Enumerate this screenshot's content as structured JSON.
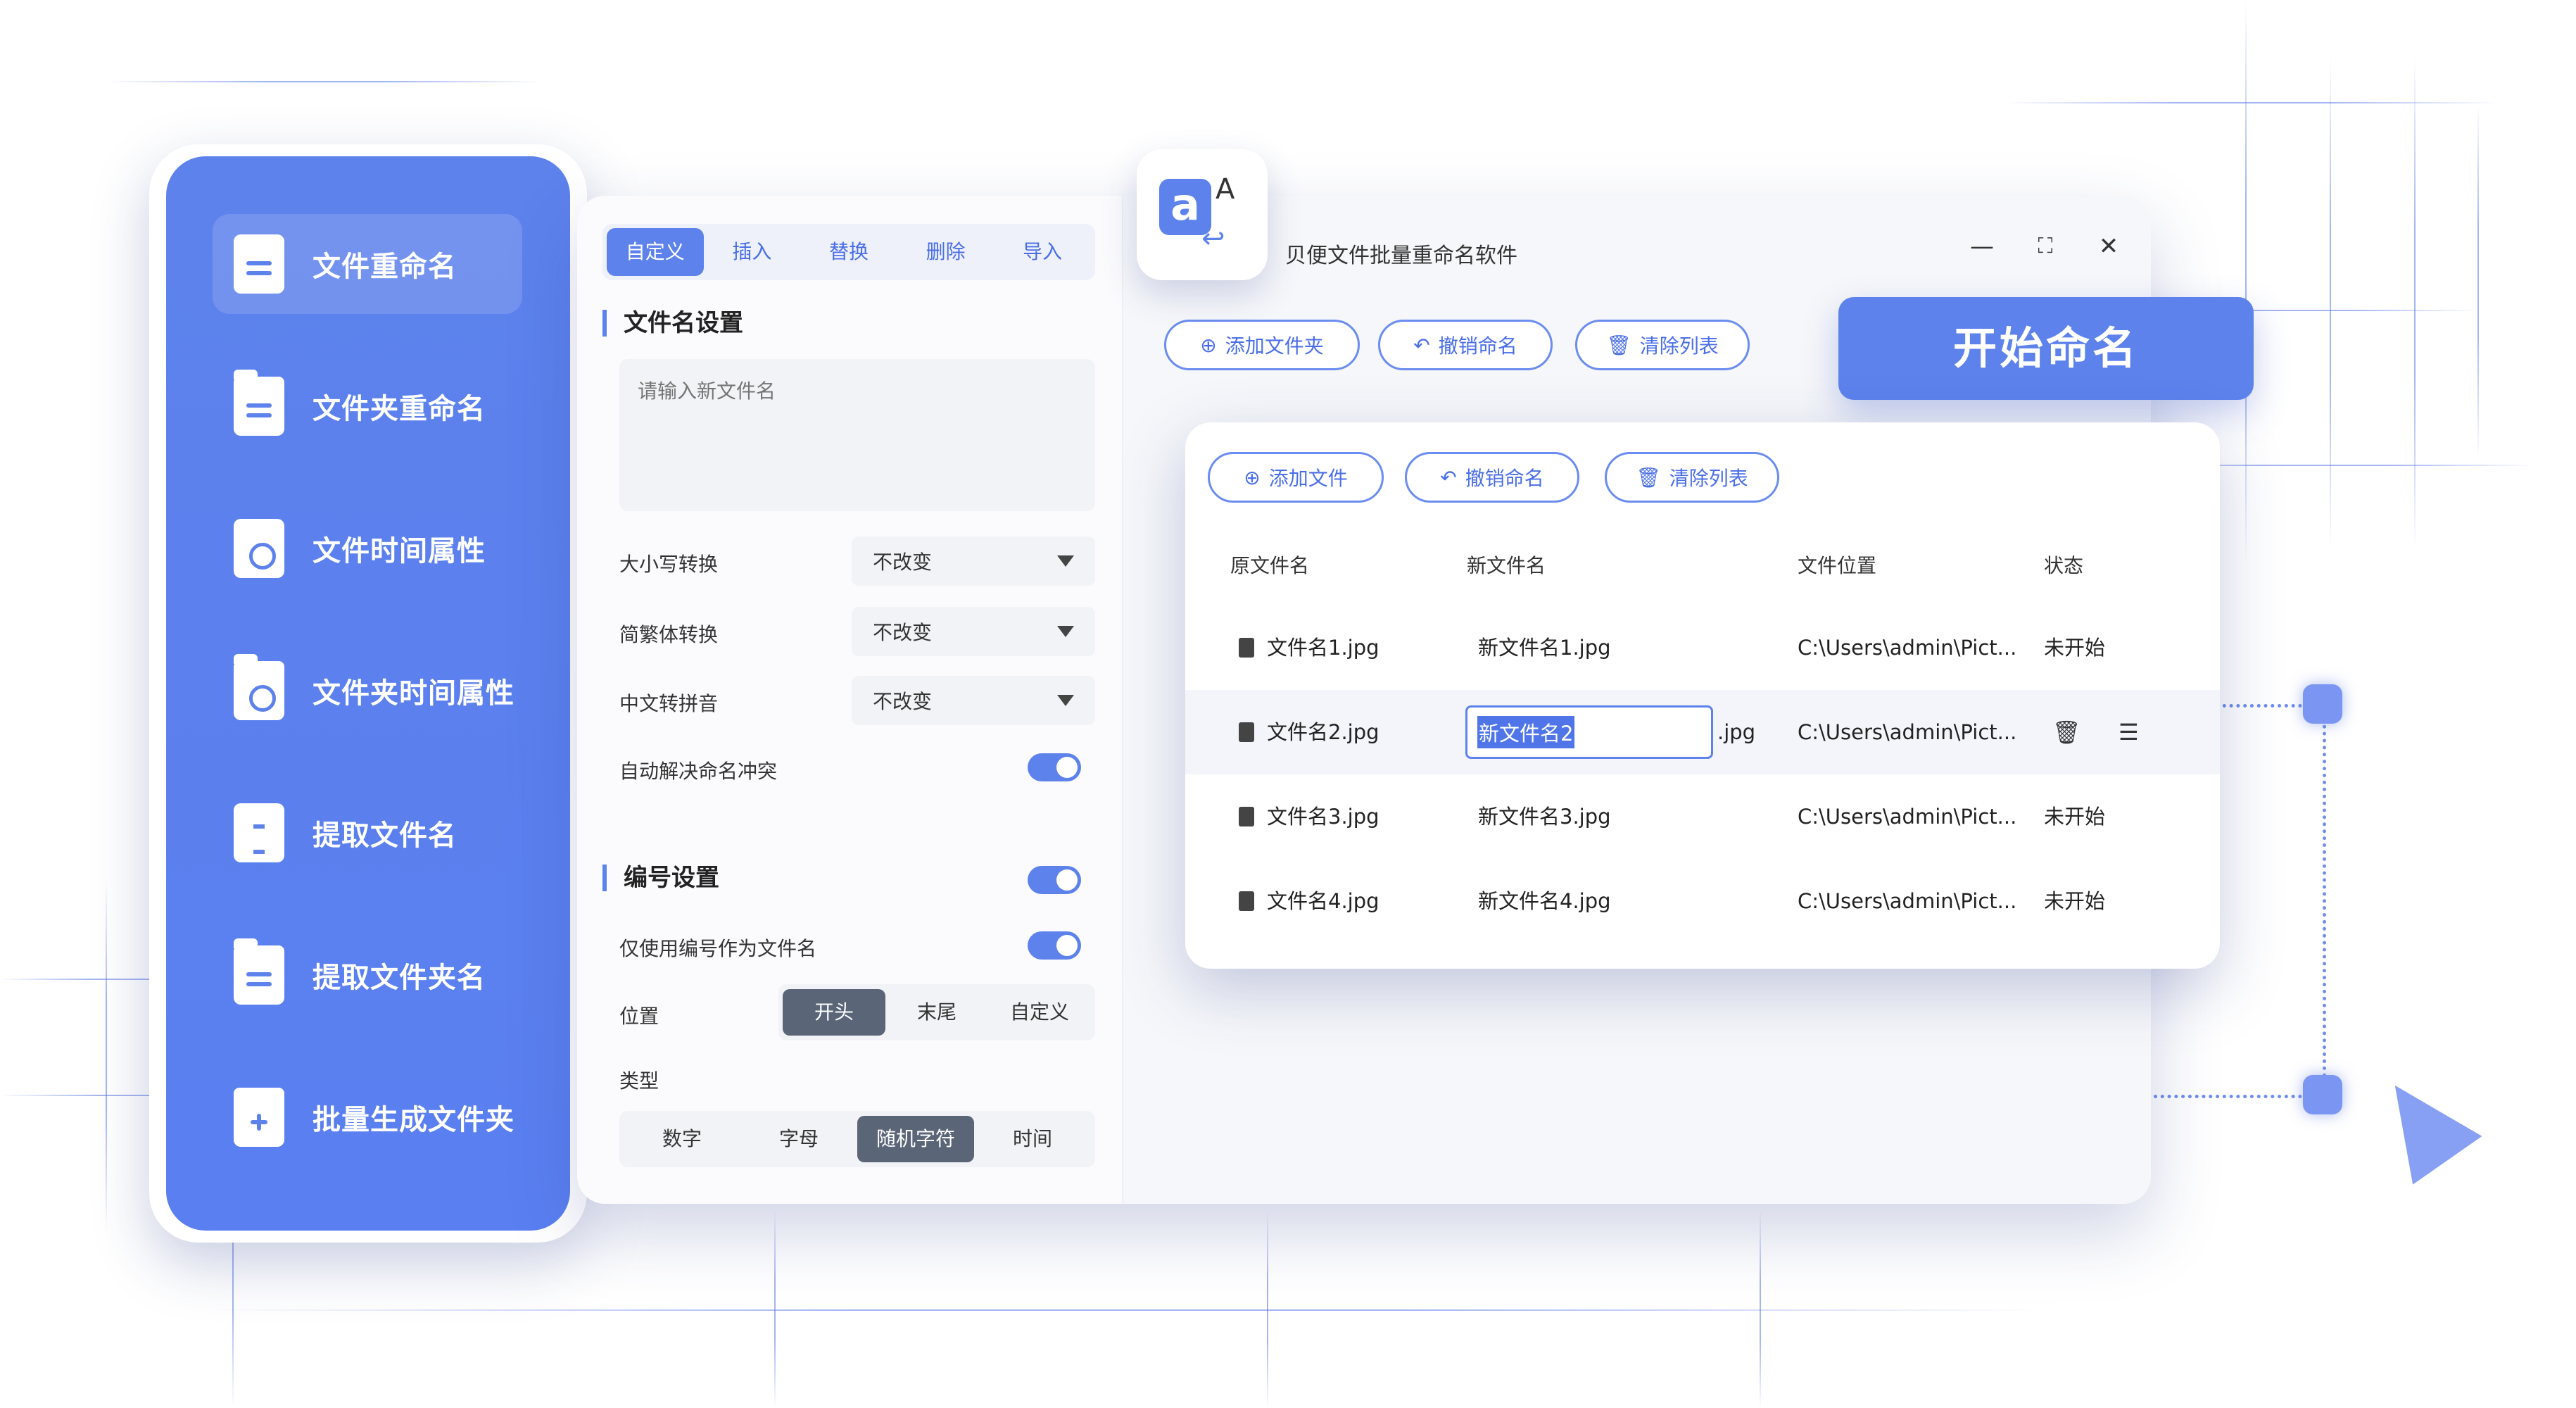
{
  "sidebar": {
    "items": [
      {
        "label": "文件重命名",
        "icon": "document-icon",
        "active": true
      },
      {
        "label": "文件夹重命名",
        "icon": "folder-icon",
        "active": false
      },
      {
        "label": "文件时间属性",
        "icon": "file-clock-icon",
        "active": false
      },
      {
        "label": "文件夹时间属性",
        "icon": "folder-clock-icon",
        "active": false
      },
      {
        "label": "提取文件名",
        "icon": "file-upload-icon",
        "active": false
      },
      {
        "label": "提取文件夹名",
        "icon": "folder-extract-icon",
        "active": false
      },
      {
        "label": "批量生成文件夹",
        "icon": "folder-plus-icon",
        "active": false
      }
    ]
  },
  "settings": {
    "tabs": [
      "自定义",
      "插入",
      "替换",
      "删除",
      "导入"
    ],
    "active_tab": "自定义",
    "filename_section": "文件名设置",
    "filename_placeholder": "请输入新文件名",
    "case_label": "大小写转换",
    "case_value": "不改变",
    "trad_label": "简繁体转换",
    "trad_value": "不改变",
    "pinyin_label": "中文转拼音",
    "pinyin_value": "不改变",
    "conflict_label": "自动解决命名冲突",
    "numbering_section": "编号设置",
    "only_number_label": "仅使用编号作为文件名",
    "position_label": "位置",
    "position_options": [
      "开头",
      "末尾",
      "自定义"
    ],
    "position_selected": "开头",
    "type_label": "类型",
    "type_options": [
      "数字",
      "字母",
      "随机字符",
      "时间"
    ],
    "type_selected": "随机字符"
  },
  "titlebar": {
    "title": "贝便文件批量重命名软件",
    "minimize": "—",
    "maximize": "⛶",
    "close": "✕"
  },
  "top_toolbar": {
    "add_folder": "添加文件夹",
    "undo_rename": "撤销命名",
    "clear_list": "清除列表"
  },
  "start_button": "开始命名",
  "file_panel": {
    "add_file": "添加文件",
    "undo_rename": "撤销命名",
    "clear_list": "清除列表",
    "columns": [
      "原文件名",
      "新文件名",
      "文件位置",
      "状态"
    ],
    "rows": [
      {
        "original": "文件名1.jpg",
        "new": "新文件名1.jpg",
        "location": "C:\\Users\\admin\\Pict...",
        "status": "未开始"
      },
      {
        "original": "文件名2.jpg",
        "new": "新文件名2",
        "new_ext": ".jpg",
        "location": "C:\\Users\\admin\\Pict...",
        "status": "",
        "editing": true
      },
      {
        "original": "文件名3.jpg",
        "new": "新文件名3.jpg",
        "location": "C:\\Users\\admin\\Pict...",
        "status": "未开始"
      },
      {
        "original": "文件名4.jpg",
        "new": "新文件名4.jpg",
        "location": "C:\\Users\\admin\\Pict...",
        "status": "未开始"
      }
    ]
  },
  "colors": {
    "accent": "#5d82ec",
    "accent_text": "#4a6ee8",
    "segment_dark": "#5a6577"
  }
}
